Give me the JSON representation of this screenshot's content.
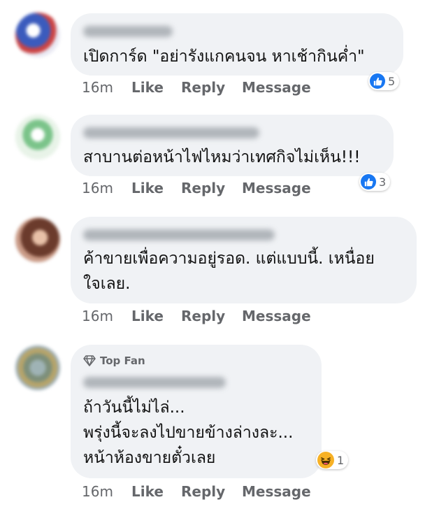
{
  "comments": [
    {
      "badge": "",
      "text": "เปิดการ์ด \"อย่ารังแกคนจน หาเช้ากินค่ำ\"",
      "time": "16m",
      "like": "Like",
      "reply": "Reply",
      "message": "Message",
      "reaction_icon": "like-icon",
      "reaction_count": "5"
    },
    {
      "badge": "",
      "text": "สาบานต่อหน้าไฟไหมว่าเทศกิจไม่เห็น!!!",
      "time": "16m",
      "like": "Like",
      "reply": "Reply",
      "message": "Message",
      "reaction_icon": "like-icon",
      "reaction_count": "3"
    },
    {
      "badge": "",
      "text": "ค้าขายเพื่อความอยู่รอด. แต่แบบนี้. เหนื่อย\nใจเลย.",
      "time": "16m",
      "like": "Like",
      "reply": "Reply",
      "message": "Message",
      "reaction_icon": "",
      "reaction_count": ""
    },
    {
      "badge": "Top Fan",
      "text": "ถ้าวันนี้ไม่ไล่...\nพรุ่งนี้จะลงไปขายข้างล่างละ...\nหน้าห้องขายตั๋วเลย",
      "time": "16m",
      "like": "Like",
      "reply": "Reply",
      "message": "Message",
      "reaction_icon": "haha-icon",
      "reaction_count": "1"
    }
  ],
  "colors": {
    "bubble": "#f0f2f5",
    "action_text": "#65676b",
    "like_blue": "#1877f2",
    "haha_yellow": "#f7b125"
  }
}
